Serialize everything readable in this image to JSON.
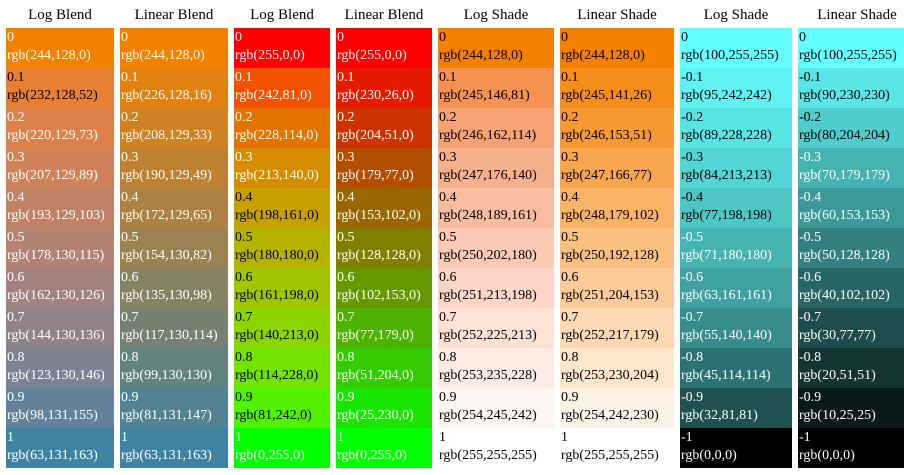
{
  "columns": [
    {
      "title": "Log Blend",
      "width": 108,
      "cells": [
        {
          "step": "0",
          "rgb": "rgb(244,128,0)"
        },
        {
          "step": "0.1",
          "rgb": "rgb(232,128,52)"
        },
        {
          "step": "0.2",
          "rgb": "rgb(220,129,73)"
        },
        {
          "step": "0.3",
          "rgb": "rgb(207,129,89)"
        },
        {
          "step": "0.4",
          "rgb": "rgb(193,129,103)"
        },
        {
          "step": "0.5",
          "rgb": "rgb(178,130,115)"
        },
        {
          "step": "0.6",
          "rgb": "rgb(162,130,126)"
        },
        {
          "step": "0.7",
          "rgb": "rgb(144,130,136)"
        },
        {
          "step": "0.8",
          "rgb": "rgb(123,130,146)"
        },
        {
          "step": "0.9",
          "rgb": "rgb(98,131,155)"
        },
        {
          "step": "1",
          "rgb": "rgb(63,131,163)"
        }
      ]
    },
    {
      "title": "Linear Blend",
      "width": 108,
      "cells": [
        {
          "step": "0",
          "rgb": "rgb(244,128,0)"
        },
        {
          "step": "0.1",
          "rgb": "rgb(226,128,16)"
        },
        {
          "step": "0.2",
          "rgb": "rgb(208,129,33)"
        },
        {
          "step": "0.3",
          "rgb": "rgb(190,129,49)"
        },
        {
          "step": "0.4",
          "rgb": "rgb(172,129,65)"
        },
        {
          "step": "0.5",
          "rgb": "rgb(154,130,82)"
        },
        {
          "step": "0.6",
          "rgb": "rgb(135,130,98)"
        },
        {
          "step": "0.7",
          "rgb": "rgb(117,130,114)"
        },
        {
          "step": "0.8",
          "rgb": "rgb(99,130,130)"
        },
        {
          "step": "0.9",
          "rgb": "rgb(81,131,147)"
        },
        {
          "step": "1",
          "rgb": "rgb(63,131,163)"
        }
      ]
    },
    {
      "title": "Log Blend",
      "width": 96,
      "cells": [
        {
          "step": "0",
          "rgb": "rgb(255,0,0)"
        },
        {
          "step": "0.1",
          "rgb": "rgb(242,81,0)"
        },
        {
          "step": "0.2",
          "rgb": "rgb(228,114,0)"
        },
        {
          "step": "0.3",
          "rgb": "rgb(213,140,0)"
        },
        {
          "step": "0.4",
          "rgb": "rgb(198,161,0)"
        },
        {
          "step": "0.5",
          "rgb": "rgb(180,180,0)"
        },
        {
          "step": "0.6",
          "rgb": "rgb(161,198,0)"
        },
        {
          "step": "0.7",
          "rgb": "rgb(140,213,0)"
        },
        {
          "step": "0.8",
          "rgb": "rgb(114,228,0)"
        },
        {
          "step": "0.9",
          "rgb": "rgb(81,242,0)"
        },
        {
          "step": "1",
          "rgb": "rgb(0,255,0)"
        }
      ]
    },
    {
      "title": "Linear Blend",
      "width": 96,
      "cells": [
        {
          "step": "0",
          "rgb": "rgb(255,0,0)"
        },
        {
          "step": "0.1",
          "rgb": "rgb(230,26,0)"
        },
        {
          "step": "0.2",
          "rgb": "rgb(204,51,0)"
        },
        {
          "step": "0.3",
          "rgb": "rgb(179,77,0)"
        },
        {
          "step": "0.4",
          "rgb": "rgb(153,102,0)"
        },
        {
          "step": "0.5",
          "rgb": "rgb(128,128,0)"
        },
        {
          "step": "0.6",
          "rgb": "rgb(102,153,0)"
        },
        {
          "step": "0.7",
          "rgb": "rgb(77,179,0)"
        },
        {
          "step": "0.8",
          "rgb": "rgb(51,204,0)"
        },
        {
          "step": "0.9",
          "rgb": "rgb(25,230,0)"
        },
        {
          "step": "1",
          "rgb": "rgb(0,255,0)"
        }
      ]
    },
    {
      "title": "Log Shade",
      "width": 116,
      "cells": [
        {
          "step": "0",
          "rgb": "rgb(244,128,0)"
        },
        {
          "step": "0.1",
          "rgb": "rgb(245,146,81)"
        },
        {
          "step": "0.2",
          "rgb": "rgb(246,162,114)"
        },
        {
          "step": "0.3",
          "rgb": "rgb(247,176,140)"
        },
        {
          "step": "0.4",
          "rgb": "rgb(248,189,161)"
        },
        {
          "step": "0.5",
          "rgb": "rgb(250,202,180)"
        },
        {
          "step": "0.6",
          "rgb": "rgb(251,213,198)"
        },
        {
          "step": "0.7",
          "rgb": "rgb(252,225,213)"
        },
        {
          "step": "0.8",
          "rgb": "rgb(253,235,228)"
        },
        {
          "step": "0.9",
          "rgb": "rgb(254,245,242)"
        },
        {
          "step": "1",
          "rgb": "rgb(255,255,255)"
        }
      ]
    },
    {
      "title": "Linear Shade",
      "width": 114,
      "cells": [
        {
          "step": "0",
          "rgb": "rgb(244,128,0)"
        },
        {
          "step": "0.1",
          "rgb": "rgb(245,141,26)"
        },
        {
          "step": "0.2",
          "rgb": "rgb(246,153,51)"
        },
        {
          "step": "0.3",
          "rgb": "rgb(247,166,77)"
        },
        {
          "step": "0.4",
          "rgb": "rgb(248,179,102)"
        },
        {
          "step": "0.5",
          "rgb": "rgb(250,192,128)"
        },
        {
          "step": "0.6",
          "rgb": "rgb(251,204,153)"
        },
        {
          "step": "0.7",
          "rgb": "rgb(252,217,179)"
        },
        {
          "step": "0.8",
          "rgb": "rgb(253,230,204)"
        },
        {
          "step": "0.9",
          "rgb": "rgb(254,242,230)"
        },
        {
          "step": "1",
          "rgb": "rgb(255,255,255)"
        }
      ]
    },
    {
      "title": "Log Shade",
      "width": 112,
      "cells": [
        {
          "step": "0",
          "rgb": "rgb(100,255,255)"
        },
        {
          "step": "-0.1",
          "rgb": "rgb(95,242,242)"
        },
        {
          "step": "-0.2",
          "rgb": "rgb(89,228,228)"
        },
        {
          "step": "-0.3",
          "rgb": "rgb(84,213,213)"
        },
        {
          "step": "-0.4",
          "rgb": "rgb(77,198,198)"
        },
        {
          "step": "-0.5",
          "rgb": "rgb(71,180,180)"
        },
        {
          "step": "-0.6",
          "rgb": "rgb(63,161,161)"
        },
        {
          "step": "-0.7",
          "rgb": "rgb(55,140,140)"
        },
        {
          "step": "-0.8",
          "rgb": "rgb(45,114,114)"
        },
        {
          "step": "-0.9",
          "rgb": "rgb(32,81,81)"
        },
        {
          "step": "-1",
          "rgb": "rgb(0,0,0)"
        }
      ]
    },
    {
      "title": "Linear Shade",
      "width": 118,
      "cells": [
        {
          "step": "0",
          "rgb": "rgb(100,255,255)"
        },
        {
          "step": "-0.1",
          "rgb": "rgb(90,230,230)"
        },
        {
          "step": "-0.2",
          "rgb": "rgb(80,204,204)"
        },
        {
          "step": "-0.3",
          "rgb": "rgb(70,179,179)"
        },
        {
          "step": "-0.4",
          "rgb": "rgb(60,153,153)"
        },
        {
          "step": "-0.5",
          "rgb": "rgb(50,128,128)"
        },
        {
          "step": "-0.6",
          "rgb": "rgb(40,102,102)"
        },
        {
          "step": "-0.7",
          "rgb": "rgb(30,77,77)"
        },
        {
          "step": "-0.8",
          "rgb": "rgb(20,51,51)"
        },
        {
          "step": "-0.9",
          "rgb": "rgb(10,25,25)"
        },
        {
          "step": "-1",
          "rgb": "rgb(0,0,0)"
        }
      ]
    }
  ]
}
